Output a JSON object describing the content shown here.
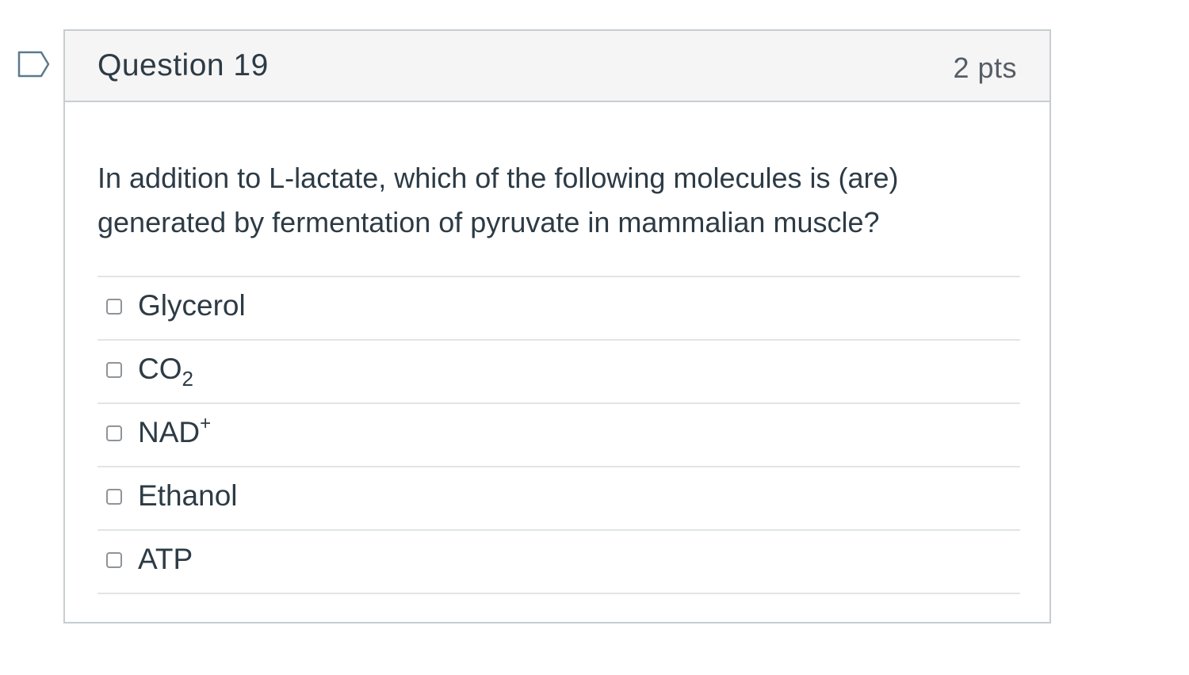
{
  "question": {
    "title": "Question 19",
    "points": "2 pts",
    "text": "In addition to L-lactate, which of the following molecules is (are) generated by fermentation of pyruvate in mammalian muscle?"
  },
  "answers": [
    {
      "label": "Glycerol",
      "sub": "",
      "sup": "",
      "checked": false
    },
    {
      "label": "CO",
      "sub": "2",
      "sup": "",
      "checked": false
    },
    {
      "label": "NAD",
      "sub": "",
      "sup": "+",
      "checked": false
    },
    {
      "label": "Ethanol",
      "sub": "",
      "sup": "",
      "checked": false
    },
    {
      "label": "ATP",
      "sub": "",
      "sup": "",
      "checked": false
    }
  ],
  "icons": {
    "flag": "flag-icon"
  },
  "colors": {
    "header_bg": "#f5f5f5",
    "border": "#c7cdd1",
    "text": "#2d3b45",
    "flag_stroke": "#5b7a8c"
  }
}
